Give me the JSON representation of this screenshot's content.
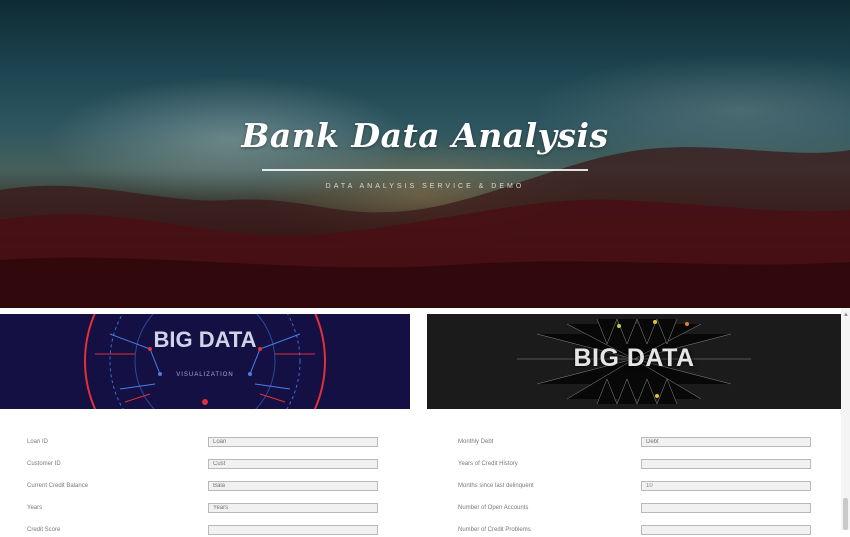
{
  "hero": {
    "title": "Bank Data Analysis",
    "subtitle": "DATA ANALYSIS SERVICE & DEMO"
  },
  "images": {
    "left": {
      "title": "BIG DATA",
      "subtitle": "VISUALIZATION"
    },
    "right": {
      "title": "BIG DATA"
    }
  },
  "form_left": {
    "fields": [
      {
        "label": "Loan ID",
        "value": "",
        "placeholder": "Loan"
      },
      {
        "label": "Customer ID",
        "value": "",
        "placeholder": "Cust"
      },
      {
        "label": "Current Credit Balance",
        "value": "",
        "placeholder": "Bala"
      },
      {
        "label": "Years",
        "value": "",
        "placeholder": "Years"
      },
      {
        "label": "Credit Score",
        "value": "",
        "placeholder": ""
      }
    ]
  },
  "form_right": {
    "fields": [
      {
        "label": "Monthly Debt",
        "value": "",
        "placeholder": "Debt"
      },
      {
        "label": "Years of Credit History",
        "value": "",
        "placeholder": ""
      },
      {
        "label": "Months since last delinquent",
        "value": "10",
        "placeholder": ""
      },
      {
        "label": "Number of Open Accounts",
        "value": "",
        "placeholder": ""
      },
      {
        "label": "Number of Credit Problems",
        "value": "",
        "placeholder": ""
      }
    ]
  },
  "colors": {
    "left_panel_bg": "#141043",
    "right_panel_bg": "#1b1b1b",
    "accent_red": "#e0303a",
    "accent_blue": "#3a6ed8"
  }
}
